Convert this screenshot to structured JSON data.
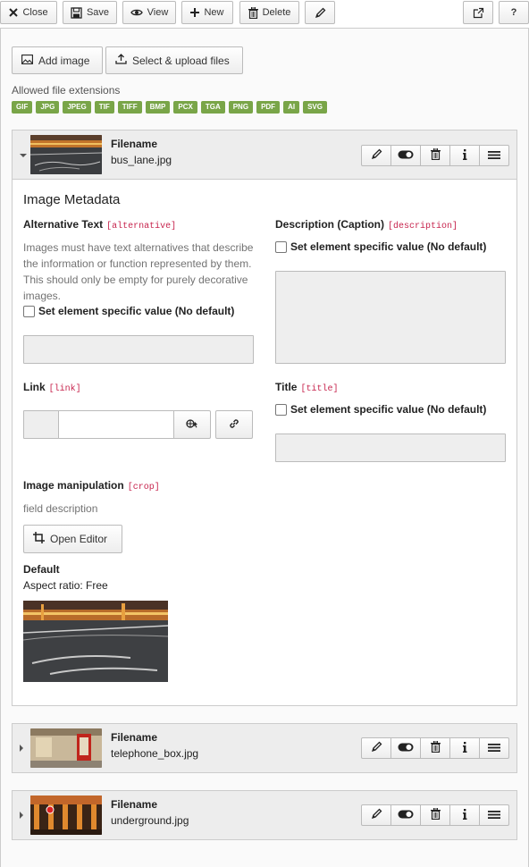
{
  "toolbar": {
    "close_label": "Close",
    "save_label": "Save",
    "view_label": "View",
    "new_label": "New",
    "delete_label": "Delete",
    "help_label": "?"
  },
  "upload": {
    "add_image_label": "Add image",
    "select_upload_label": "Select & upload files",
    "allowed_label": "Allowed file extensions",
    "extensions": [
      "GIF",
      "JPG",
      "JPEG",
      "TIF",
      "TIFF",
      "BMP",
      "PCX",
      "TGA",
      "PNG",
      "PDF",
      "AI",
      "SVG"
    ]
  },
  "files": [
    {
      "heading": "Filename",
      "name": "bus_lane.jpg",
      "expanded": true
    },
    {
      "heading": "Filename",
      "name": "telephone_box.jpg",
      "expanded": false
    },
    {
      "heading": "Filename",
      "name": "underground.jpg",
      "expanded": false
    }
  ],
  "metadata": {
    "title": "Image Metadata",
    "alt_label": "Alternative Text",
    "alt_tag": "[alternative]",
    "alt_help": "Images must have text alternatives that describe the information or function represented by them. This should only be empty for purely decorative images.",
    "alt_checkbox": "Set element specific value (No default)",
    "desc_label": "Description (Caption)",
    "desc_tag": "[description]",
    "desc_checkbox": "Set element specific value (No default)",
    "link_label": "Link",
    "link_tag": "[link]",
    "title_label": "Title",
    "title_tag": "[title]",
    "title_checkbox": "Set element specific value (No default)",
    "crop_label": "Image manipulation",
    "crop_tag": "[crop]",
    "crop_help": "field description",
    "open_editor_label": "Open Editor",
    "default_label": "Default",
    "aspect_ratio": "Aspect ratio: Free"
  },
  "colors": {
    "extension_badge": "#79a548",
    "field_tag": "#c7254e",
    "panel_header": "#ededed"
  }
}
